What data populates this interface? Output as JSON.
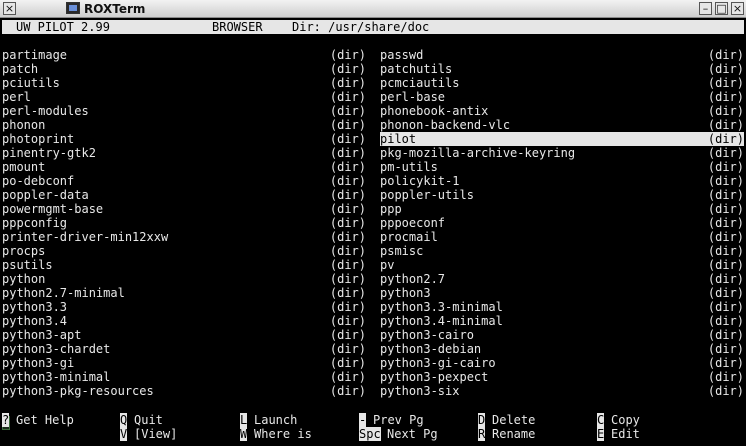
{
  "window": {
    "title": "ROXTerm",
    "close_glyph": "×",
    "minimize_glyph": "–",
    "maximize_glyph": "□",
    "x_glyph": "×"
  },
  "status": {
    "program": "UW PILOT 2.99",
    "mode": "BROWSER",
    "dir": "Dir: /usr/share/doc"
  },
  "list": {
    "left": [
      {
        "name": "partimage",
        "type": "(dir)"
      },
      {
        "name": "patch",
        "type": "(dir)"
      },
      {
        "name": "pciutils",
        "type": "(dir)"
      },
      {
        "name": "perl",
        "type": "(dir)"
      },
      {
        "name": "perl-modules",
        "type": "(dir)"
      },
      {
        "name": "phonon",
        "type": "(dir)"
      },
      {
        "name": "photoprint",
        "type": "(dir)"
      },
      {
        "name": "pinentry-gtk2",
        "type": "(dir)"
      },
      {
        "name": "pmount",
        "type": "(dir)"
      },
      {
        "name": "po-debconf",
        "type": "(dir)"
      },
      {
        "name": "poppler-data",
        "type": "(dir)"
      },
      {
        "name": "powermgmt-base",
        "type": "(dir)"
      },
      {
        "name": "pppconfig",
        "type": "(dir)"
      },
      {
        "name": "printer-driver-min12xxw",
        "type": "(dir)"
      },
      {
        "name": "procps",
        "type": "(dir)"
      },
      {
        "name": "psutils",
        "type": "(dir)"
      },
      {
        "name": "python",
        "type": "(dir)"
      },
      {
        "name": "python2.7-minimal",
        "type": "(dir)"
      },
      {
        "name": "python3.3",
        "type": "(dir)"
      },
      {
        "name": "python3.4",
        "type": "(dir)"
      },
      {
        "name": "python3-apt",
        "type": "(dir)"
      },
      {
        "name": "python3-chardet",
        "type": "(dir)"
      },
      {
        "name": "python3-gi",
        "type": "(dir)"
      },
      {
        "name": "python3-minimal",
        "type": "(dir)"
      },
      {
        "name": "python3-pkg-resources",
        "type": "(dir)"
      }
    ],
    "right": [
      {
        "name": "passwd",
        "type": "(dir)"
      },
      {
        "name": "patchutils",
        "type": "(dir)"
      },
      {
        "name": "pcmciautils",
        "type": "(dir)"
      },
      {
        "name": "perl-base",
        "type": "(dir)"
      },
      {
        "name": "phonebook-antix",
        "type": "(dir)"
      },
      {
        "name": "phonon-backend-vlc",
        "type": "(dir)"
      },
      {
        "name": "pilot",
        "type": "(dir)",
        "selected": true
      },
      {
        "name": "pkg-mozilla-archive-keyring",
        "type": "(dir)"
      },
      {
        "name": "pm-utils",
        "type": "(dir)"
      },
      {
        "name": "policykit-1",
        "type": "(dir)"
      },
      {
        "name": "poppler-utils",
        "type": "(dir)"
      },
      {
        "name": "ppp",
        "type": "(dir)"
      },
      {
        "name": "pppoeconf",
        "type": "(dir)"
      },
      {
        "name": "procmail",
        "type": "(dir)"
      },
      {
        "name": "psmisc",
        "type": "(dir)"
      },
      {
        "name": "pv",
        "type": "(dir)"
      },
      {
        "name": "python2.7",
        "type": "(dir)"
      },
      {
        "name": "python3",
        "type": "(dir)"
      },
      {
        "name": "python3.3-minimal",
        "type": "(dir)"
      },
      {
        "name": "python3.4-minimal",
        "type": "(dir)"
      },
      {
        "name": "python3-cairo",
        "type": "(dir)"
      },
      {
        "name": "python3-debian",
        "type": "(dir)"
      },
      {
        "name": "python3-gi-cairo",
        "type": "(dir)"
      },
      {
        "name": "python3-pexpect",
        "type": "(dir)"
      },
      {
        "name": "python3-six",
        "type": "(dir)"
      }
    ]
  },
  "commands": [
    {
      "key": "?",
      "label": "Get Help"
    },
    {
      "key": "Q",
      "label": "Quit"
    },
    {
      "key": "L",
      "label": "Launch"
    },
    {
      "key": "-",
      "label": "Prev Pg"
    },
    {
      "key": "D",
      "label": "Delete"
    },
    {
      "key": "C",
      "label": "Copy"
    },
    {
      "key": "",
      "label": ""
    },
    {
      "key": "V",
      "label": "[View]"
    },
    {
      "key": "W",
      "label": "Where is"
    },
    {
      "key": "Spc",
      "label": "Next Pg"
    },
    {
      "key": "R",
      "label": "Rename"
    },
    {
      "key": "E",
      "label": "Edit"
    }
  ]
}
